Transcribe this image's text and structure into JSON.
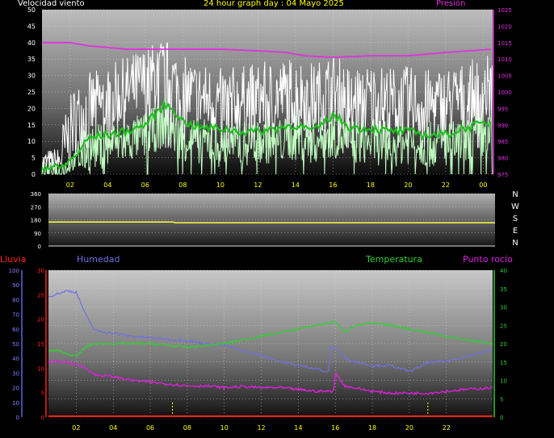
{
  "labels": {
    "wind": "Velocidad viento",
    "title": "24 hour graph day : 04 Mayo 2025",
    "pressure": "Presión",
    "rain": "Lluvia",
    "humidity": "Humedad",
    "temperature": "Temperatura",
    "dewpoint": "Punto rocío"
  },
  "colors": {
    "wind_title": "#ffffff",
    "title": "#ffff00",
    "pressure": "#e030e0",
    "gust": "#ffffff",
    "wind_speed": "#c0ffc0",
    "wind_avg": "#20c020",
    "direction": "#ffff40",
    "rain": "#ff2020",
    "humidity": "#7070e0",
    "temperature": "#30d030",
    "dewpoint": "#e020e0",
    "axis_yellow": "#ffff00"
  },
  "chart_data": [
    {
      "type": "line",
      "name": "wind-pressure",
      "x_ticks": [
        "02",
        "04",
        "06",
        "08",
        "10",
        "12",
        "14",
        "16",
        "18",
        "20",
        "22",
        "00"
      ],
      "xlim": [
        0.5,
        24.5
      ],
      "y_left": {
        "label": "Velocidad viento",
        "lim": [
          0,
          50
        ],
        "ticks": [
          0,
          5,
          10,
          15,
          20,
          25,
          30,
          35,
          40,
          45,
          50
        ]
      },
      "y_right": {
        "label": "Presión",
        "lim": [
          975,
          1025
        ],
        "ticks": [
          975,
          980,
          985,
          990,
          995,
          1000,
          1005,
          1010,
          1015,
          1020,
          1025
        ]
      },
      "series": [
        {
          "axis": "right",
          "x": [
            0.5,
            2,
            3,
            5,
            6,
            8,
            10,
            12,
            13.5,
            14.5,
            16,
            18,
            20,
            22,
            24.5
          ],
          "values": [
            1015,
            1015,
            1014,
            1013,
            1013,
            1013,
            1013,
            1012.5,
            1012,
            1011,
            1010.5,
            1011,
            1011,
            1012,
            1013
          ]
        },
        {
          "axis": "left",
          "x": [
            0.5,
            1.5,
            2.2,
            3,
            4,
            5,
            6,
            7,
            7.5,
            8,
            9,
            10,
            11,
            12,
            13,
            14,
            15,
            16,
            17,
            18,
            19,
            20,
            21,
            22,
            23,
            24.5
          ],
          "values": [
            2,
            2,
            5,
            11,
            12,
            13,
            15,
            21,
            20,
            16,
            14,
            14,
            13,
            13,
            14,
            15,
            13,
            18,
            14,
            14,
            13,
            13,
            12,
            12,
            14,
            16
          ]
        },
        {
          "axis": "left",
          "x": [
            0.5,
            1.5,
            2.2,
            3,
            4,
            5,
            6,
            7,
            8,
            9,
            10,
            11,
            12,
            13,
            14,
            15,
            16,
            17,
            18,
            19,
            20,
            21,
            22,
            23,
            24.5
          ],
          "values": [
            3,
            4,
            16,
            20,
            22,
            25,
            28,
            31,
            25,
            23,
            22,
            22,
            23,
            24,
            25,
            23,
            26,
            22,
            23,
            22,
            22,
            21,
            22,
            23,
            26
          ]
        },
        {
          "axis": "left",
          "x": [
            0.5,
            1.5,
            2.2,
            3,
            4,
            5,
            6,
            7,
            8,
            9,
            10,
            11,
            12,
            13,
            14,
            15,
            16,
            17,
            18,
            19,
            20,
            21,
            22,
            23,
            24.5
          ],
          "values": [
            1,
            1,
            4,
            8,
            9,
            10,
            12,
            15,
            11,
            10,
            9,
            9,
            10,
            10,
            11,
            10,
            12,
            10,
            10,
            9,
            10,
            9,
            9,
            10,
            12
          ]
        }
      ]
    },
    {
      "type": "line",
      "name": "wind-direction",
      "y_left": {
        "ticks": [
          0,
          90,
          180,
          270,
          360
        ],
        "lim": [
          0,
          360
        ]
      },
      "y_right_labels": [
        "N",
        "W",
        "S",
        "E",
        "N"
      ],
      "xlim": [
        0.5,
        24.5
      ],
      "series": [
        {
          "x": [
            0.5,
            7.2,
            7.3,
            24.5
          ],
          "values": [
            165,
            165,
            160,
            160
          ]
        }
      ]
    },
    {
      "type": "line",
      "name": "temp-hum-rain",
      "x_ticks": [
        "02",
        "04",
        "06",
        "08",
        "10",
        "12",
        "14",
        "16",
        "18",
        "20",
        "22"
      ],
      "xlim": [
        0.5,
        24.5
      ],
      "y_rain": {
        "label": "Lluvia",
        "lim": [
          0,
          30
        ],
        "ticks": [
          0,
          5,
          10,
          15,
          20,
          25,
          30
        ]
      },
      "y_hum": {
        "label": "Humedad",
        "lim": [
          0,
          100
        ],
        "ticks": [
          0,
          10,
          20,
          30,
          40,
          50,
          60,
          70,
          80,
          90,
          100
        ]
      },
      "y_temp": {
        "label": "Temperatura",
        "lim": [
          0,
          40
        ],
        "ticks": [
          0,
          5,
          10,
          15,
          20,
          25,
          30,
          35,
          40
        ]
      },
      "markers_x": [
        7.2,
        21
      ],
      "series": [
        {
          "name": "Humedad",
          "axis": "hum",
          "x": [
            0.5,
            1.5,
            2,
            2.5,
            3,
            4,
            5,
            6,
            7,
            8,
            9,
            10,
            11,
            12,
            13,
            14,
            15,
            15.6,
            15.8,
            16,
            16.5,
            17,
            18,
            19,
            20,
            21,
            22,
            23,
            24.5
          ],
          "values": [
            82,
            86,
            85,
            70,
            59,
            57,
            55,
            54,
            53,
            52,
            50,
            49,
            45,
            42,
            38,
            35,
            33,
            30,
            47,
            48,
            40,
            38,
            35,
            35,
            31,
            37,
            38,
            41,
            46
          ]
        },
        {
          "name": "Temperatura",
          "axis": "temp",
          "x": [
            0.5,
            1,
            2,
            2.5,
            3,
            4,
            5,
            6,
            7,
            8,
            9,
            10,
            11,
            12,
            13,
            14,
            15,
            16,
            16.5,
            17,
            18,
            19,
            20,
            21,
            22,
            23,
            24.5
          ],
          "values": [
            18,
            18,
            16.5,
            19,
            20,
            20,
            20,
            20,
            19.5,
            19,
            19.5,
            20,
            21,
            22,
            23,
            24,
            25,
            26,
            23,
            25,
            25.5,
            25,
            24,
            23,
            22,
            21,
            20
          ]
        },
        {
          "name": "Punto rocío",
          "axis": "temp",
          "x": [
            0.5,
            1.5,
            2.5,
            3,
            4,
            5,
            6,
            7,
            8,
            9,
            10,
            11,
            12,
            13,
            14,
            15,
            15.9,
            16,
            16.5,
            17,
            18,
            19,
            20,
            21,
            22,
            23,
            24.5
          ],
          "values": [
            15,
            15,
            13.5,
            11.5,
            11,
            10,
            9.5,
            9,
            8.5,
            8.5,
            8,
            8.3,
            8,
            8,
            7.5,
            7,
            7,
            12,
            8.5,
            8,
            7,
            6.5,
            6.5,
            6.5,
            7,
            7.5,
            8
          ]
        },
        {
          "name": "Lluvia",
          "axis": "rain",
          "x": [
            0.5,
            24.5
          ],
          "values": [
            0,
            0
          ]
        }
      ]
    }
  ]
}
